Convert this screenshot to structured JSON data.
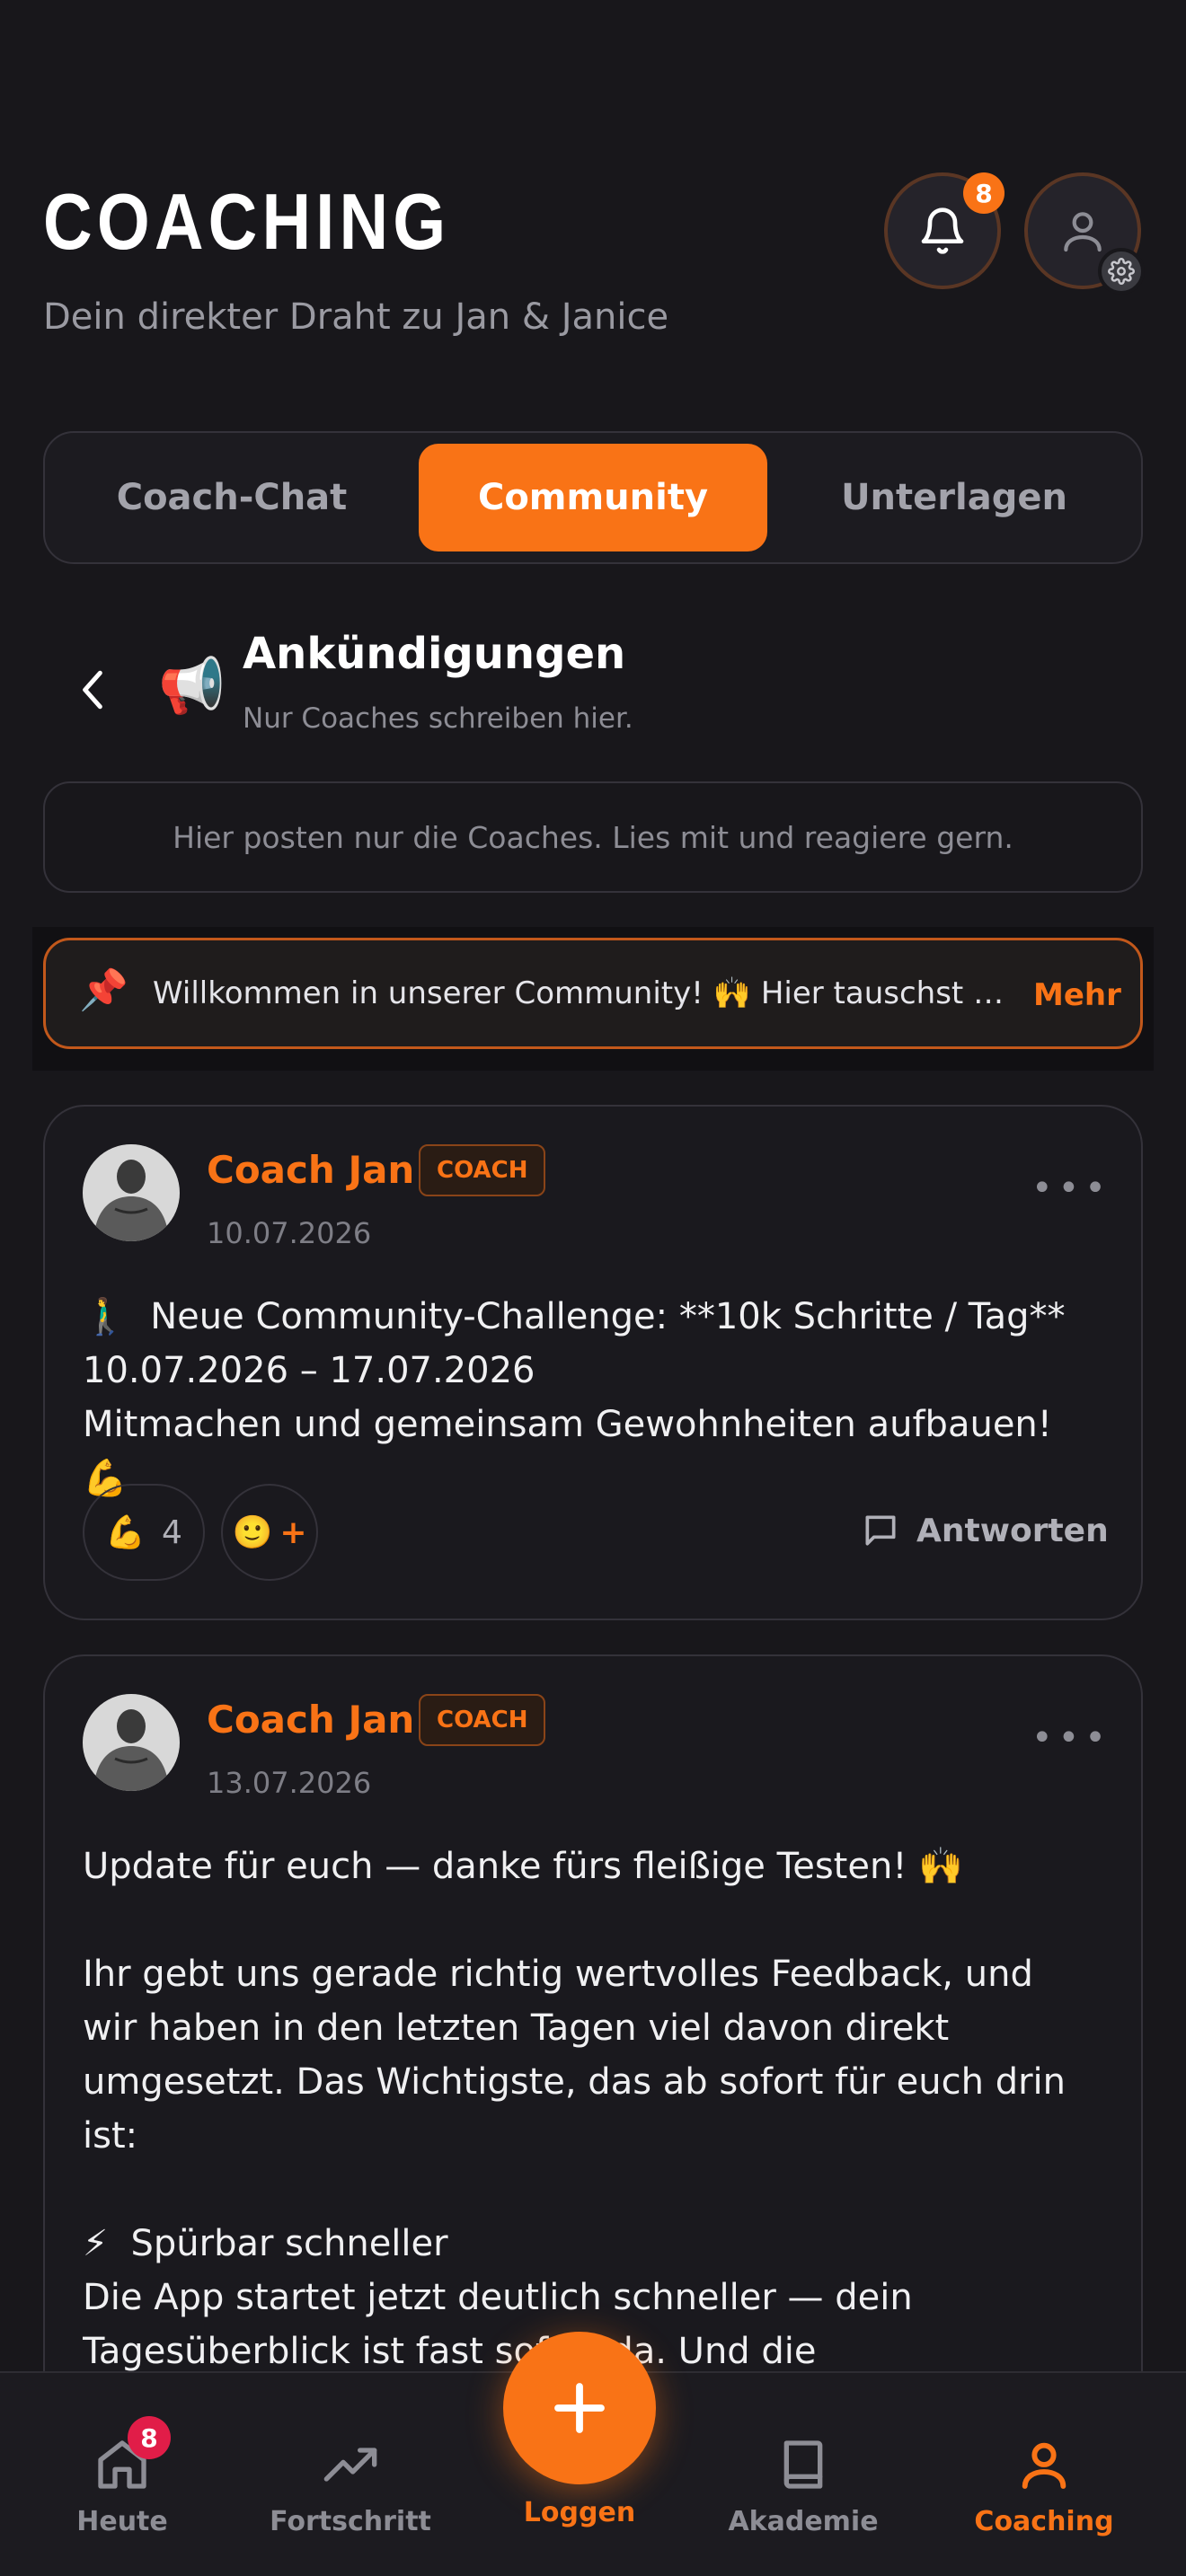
{
  "header": {
    "title": "COACHING",
    "subtitle": "Dein direkter Draht zu Jan & Janice",
    "notification_count": "8"
  },
  "tabs": [
    {
      "label": "Coach-Chat",
      "active": false
    },
    {
      "label": "Community",
      "active": true
    },
    {
      "label": "Unterlagen",
      "active": false
    }
  ],
  "channel": {
    "icon": "📢",
    "title": "Ankündigungen",
    "subtitle": "Nur Coaches schreiben hier.",
    "info": "Hier posten nur die Coaches. Lies mit und reagiere gern."
  },
  "pinned": {
    "icon": "📌",
    "text": "Willkommen in unserer Community! 🙌  Hier tauschst du…",
    "more_label": "Mehr"
  },
  "posts": [
    {
      "author": "Coach Jan",
      "badge": "COACH",
      "date": "10.07.2026",
      "body": "🚶‍♂️  Neue Community-Challenge: **10k Schritte / Tag**\n10.07.2026 – 17.07.2026\nMitmachen und gemeinsam Gewohnheiten aufbauen! 💪",
      "reaction_emoji": "💪",
      "reaction_count": "4",
      "add_reaction_emoji": "🙂",
      "add_reaction_plus": "+",
      "reply_label": "Antworten"
    },
    {
      "author": "Coach Jan",
      "badge": "COACH",
      "date": "13.07.2026",
      "body": "Update für euch — danke fürs fleißige Testen! 🙌\n\nIhr gebt uns gerade richtig wertvolles Feedback, und wir haben in den letzten Tagen viel davon direkt umgesetzt. Das Wichtigste, das ab sofort für euch drin ist:\n\n⚡  Spürbar schneller\nDie App startet jetzt deutlich schneller — dein Tagesüberblick ist fast sofort da. Und die Lebensmittelsuche funktioniert jetzt auch bei schwachem"
    }
  ],
  "bottom_nav": {
    "items": [
      {
        "label": "Heute",
        "icon": "home-icon",
        "badge": "8"
      },
      {
        "label": "Fortschritt",
        "icon": "trend-icon"
      },
      {
        "label": "Loggen",
        "icon": "plus-icon"
      },
      {
        "label": "Akademie",
        "icon": "book-icon"
      },
      {
        "label": "Coaching",
        "icon": "user-icon",
        "active": true
      }
    ]
  },
  "colors": {
    "accent": "#f97316",
    "background": "#18171b",
    "badge_red": "#e11d48"
  }
}
